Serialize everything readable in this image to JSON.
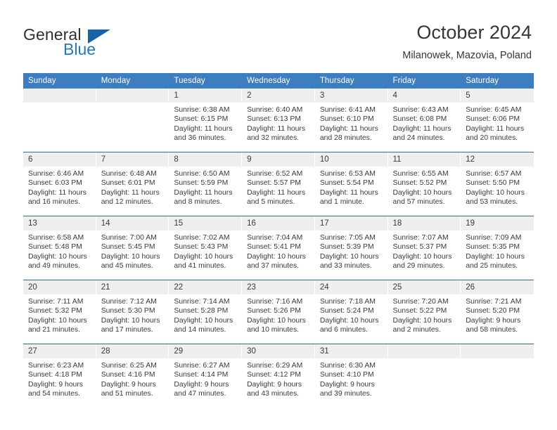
{
  "brand": {
    "name_part1": "General",
    "name_part2": "Blue",
    "logo_icon": "triangle-icon",
    "color_primary": "#1763a9",
    "color_text": "#2f2f2f"
  },
  "header": {
    "title": "October 2024",
    "subtitle": "Milanowek, Mazovia, Poland"
  },
  "calendar": {
    "accent_color": "#3c7ebf",
    "weekday_headers": [
      "Sunday",
      "Monday",
      "Tuesday",
      "Wednesday",
      "Thursday",
      "Friday",
      "Saturday"
    ],
    "weeks": [
      [
        {
          "day": "",
          "sunrise": "",
          "sunset": "",
          "daylight": ""
        },
        {
          "day": "",
          "sunrise": "",
          "sunset": "",
          "daylight": ""
        },
        {
          "day": "1",
          "sunrise": "Sunrise: 6:38 AM",
          "sunset": "Sunset: 6:15 PM",
          "daylight": "Daylight: 11 hours and 36 minutes."
        },
        {
          "day": "2",
          "sunrise": "Sunrise: 6:40 AM",
          "sunset": "Sunset: 6:13 PM",
          "daylight": "Daylight: 11 hours and 32 minutes."
        },
        {
          "day": "3",
          "sunrise": "Sunrise: 6:41 AM",
          "sunset": "Sunset: 6:10 PM",
          "daylight": "Daylight: 11 hours and 28 minutes."
        },
        {
          "day": "4",
          "sunrise": "Sunrise: 6:43 AM",
          "sunset": "Sunset: 6:08 PM",
          "daylight": "Daylight: 11 hours and 24 minutes."
        },
        {
          "day": "5",
          "sunrise": "Sunrise: 6:45 AM",
          "sunset": "Sunset: 6:06 PM",
          "daylight": "Daylight: 11 hours and 20 minutes."
        }
      ],
      [
        {
          "day": "6",
          "sunrise": "Sunrise: 6:46 AM",
          "sunset": "Sunset: 6:03 PM",
          "daylight": "Daylight: 11 hours and 16 minutes."
        },
        {
          "day": "7",
          "sunrise": "Sunrise: 6:48 AM",
          "sunset": "Sunset: 6:01 PM",
          "daylight": "Daylight: 11 hours and 12 minutes."
        },
        {
          "day": "8",
          "sunrise": "Sunrise: 6:50 AM",
          "sunset": "Sunset: 5:59 PM",
          "daylight": "Daylight: 11 hours and 8 minutes."
        },
        {
          "day": "9",
          "sunrise": "Sunrise: 6:52 AM",
          "sunset": "Sunset: 5:57 PM",
          "daylight": "Daylight: 11 hours and 5 minutes."
        },
        {
          "day": "10",
          "sunrise": "Sunrise: 6:53 AM",
          "sunset": "Sunset: 5:54 PM",
          "daylight": "Daylight: 11 hours and 1 minute."
        },
        {
          "day": "11",
          "sunrise": "Sunrise: 6:55 AM",
          "sunset": "Sunset: 5:52 PM",
          "daylight": "Daylight: 10 hours and 57 minutes."
        },
        {
          "day": "12",
          "sunrise": "Sunrise: 6:57 AM",
          "sunset": "Sunset: 5:50 PM",
          "daylight": "Daylight: 10 hours and 53 minutes."
        }
      ],
      [
        {
          "day": "13",
          "sunrise": "Sunrise: 6:58 AM",
          "sunset": "Sunset: 5:48 PM",
          "daylight": "Daylight: 10 hours and 49 minutes."
        },
        {
          "day": "14",
          "sunrise": "Sunrise: 7:00 AM",
          "sunset": "Sunset: 5:45 PM",
          "daylight": "Daylight: 10 hours and 45 minutes."
        },
        {
          "day": "15",
          "sunrise": "Sunrise: 7:02 AM",
          "sunset": "Sunset: 5:43 PM",
          "daylight": "Daylight: 10 hours and 41 minutes."
        },
        {
          "day": "16",
          "sunrise": "Sunrise: 7:04 AM",
          "sunset": "Sunset: 5:41 PM",
          "daylight": "Daylight: 10 hours and 37 minutes."
        },
        {
          "day": "17",
          "sunrise": "Sunrise: 7:05 AM",
          "sunset": "Sunset: 5:39 PM",
          "daylight": "Daylight: 10 hours and 33 minutes."
        },
        {
          "day": "18",
          "sunrise": "Sunrise: 7:07 AM",
          "sunset": "Sunset: 5:37 PM",
          "daylight": "Daylight: 10 hours and 29 minutes."
        },
        {
          "day": "19",
          "sunrise": "Sunrise: 7:09 AM",
          "sunset": "Sunset: 5:35 PM",
          "daylight": "Daylight: 10 hours and 25 minutes."
        }
      ],
      [
        {
          "day": "20",
          "sunrise": "Sunrise: 7:11 AM",
          "sunset": "Sunset: 5:32 PM",
          "daylight": "Daylight: 10 hours and 21 minutes."
        },
        {
          "day": "21",
          "sunrise": "Sunrise: 7:12 AM",
          "sunset": "Sunset: 5:30 PM",
          "daylight": "Daylight: 10 hours and 17 minutes."
        },
        {
          "day": "22",
          "sunrise": "Sunrise: 7:14 AM",
          "sunset": "Sunset: 5:28 PM",
          "daylight": "Daylight: 10 hours and 14 minutes."
        },
        {
          "day": "23",
          "sunrise": "Sunrise: 7:16 AM",
          "sunset": "Sunset: 5:26 PM",
          "daylight": "Daylight: 10 hours and 10 minutes."
        },
        {
          "day": "24",
          "sunrise": "Sunrise: 7:18 AM",
          "sunset": "Sunset: 5:24 PM",
          "daylight": "Daylight: 10 hours and 6 minutes."
        },
        {
          "day": "25",
          "sunrise": "Sunrise: 7:20 AM",
          "sunset": "Sunset: 5:22 PM",
          "daylight": "Daylight: 10 hours and 2 minutes."
        },
        {
          "day": "26",
          "sunrise": "Sunrise: 7:21 AM",
          "sunset": "Sunset: 5:20 PM",
          "daylight": "Daylight: 9 hours and 58 minutes."
        }
      ],
      [
        {
          "day": "27",
          "sunrise": "Sunrise: 6:23 AM",
          "sunset": "Sunset: 4:18 PM",
          "daylight": "Daylight: 9 hours and 54 minutes."
        },
        {
          "day": "28",
          "sunrise": "Sunrise: 6:25 AM",
          "sunset": "Sunset: 4:16 PM",
          "daylight": "Daylight: 9 hours and 51 minutes."
        },
        {
          "day": "29",
          "sunrise": "Sunrise: 6:27 AM",
          "sunset": "Sunset: 4:14 PM",
          "daylight": "Daylight: 9 hours and 47 minutes."
        },
        {
          "day": "30",
          "sunrise": "Sunrise: 6:29 AM",
          "sunset": "Sunset: 4:12 PM",
          "daylight": "Daylight: 9 hours and 43 minutes."
        },
        {
          "day": "31",
          "sunrise": "Sunrise: 6:30 AM",
          "sunset": "Sunset: 4:10 PM",
          "daylight": "Daylight: 9 hours and 39 minutes."
        },
        {
          "day": "",
          "sunrise": "",
          "sunset": "",
          "daylight": ""
        },
        {
          "day": "",
          "sunrise": "",
          "sunset": "",
          "daylight": ""
        }
      ]
    ]
  }
}
